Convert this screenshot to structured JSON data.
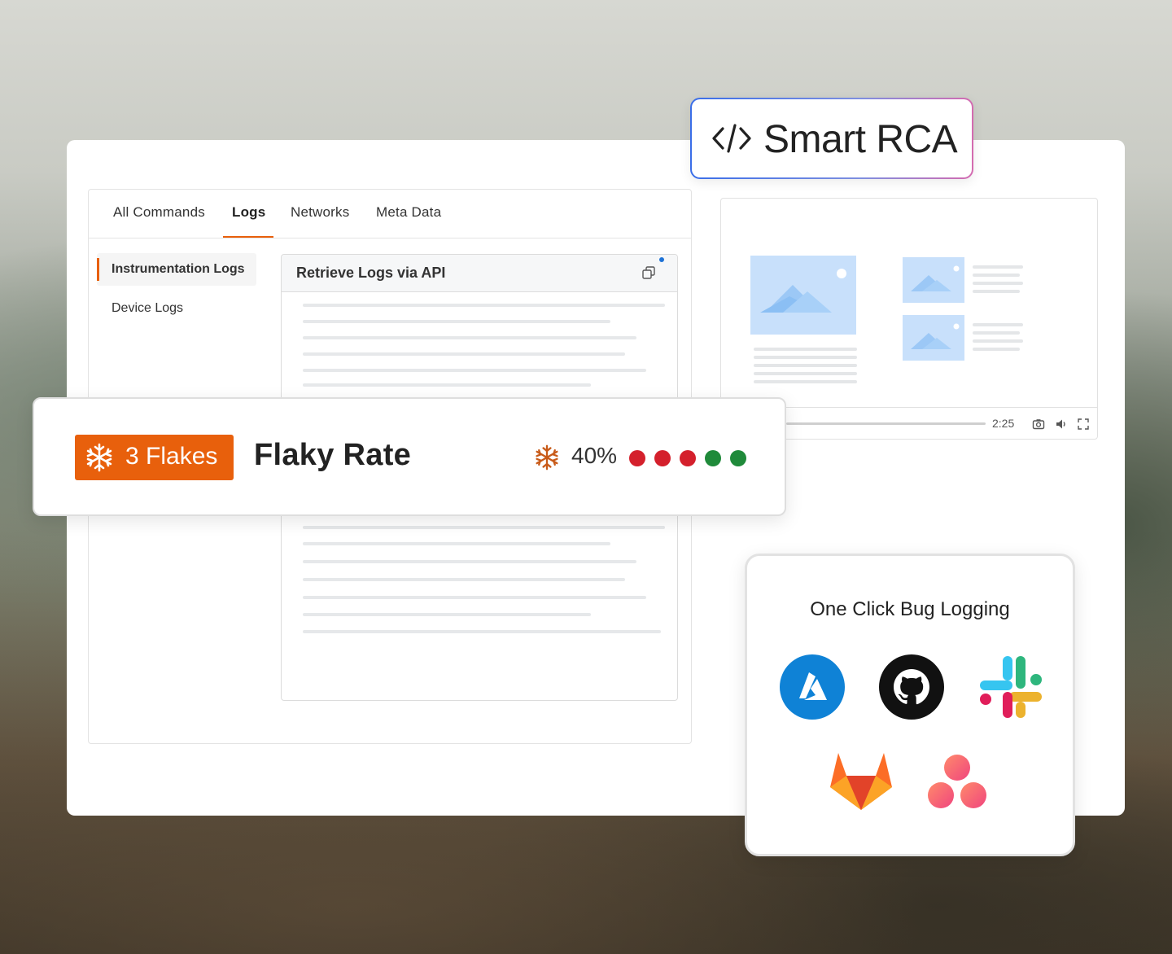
{
  "smart_rca": {
    "icon": "code-icon",
    "label": "Smart RCA"
  },
  "log_panel": {
    "tabs": [
      {
        "label": "All Commands"
      },
      {
        "label": "Logs",
        "active": true
      },
      {
        "label": "Networks"
      },
      {
        "label": "Meta Data"
      }
    ],
    "sidebar": [
      {
        "label": "Instrumentation Logs",
        "active": true
      },
      {
        "label": "Device Logs"
      }
    ],
    "api": {
      "title": "Retrieve Logs via API",
      "icon": "copy-icon"
    }
  },
  "video_player": {
    "time": "2:25",
    "icons": [
      "camera-icon",
      "volume-icon",
      "fullscreen-icon"
    ]
  },
  "flaky": {
    "badge_label": "3 Flakes",
    "title": "Flaky Rate",
    "rate": "40%",
    "dots": [
      "#d4202c",
      "#d4202c",
      "#d4202c",
      "#1f8a3a",
      "#1f8a3a"
    ],
    "accent_color": "#e8600c"
  },
  "bug_logging": {
    "title": "One Click Bug Logging",
    "integrations": [
      "azure-devops-icon",
      "github-icon",
      "slack-icon",
      "gitlab-icon",
      "asana-icon"
    ]
  }
}
